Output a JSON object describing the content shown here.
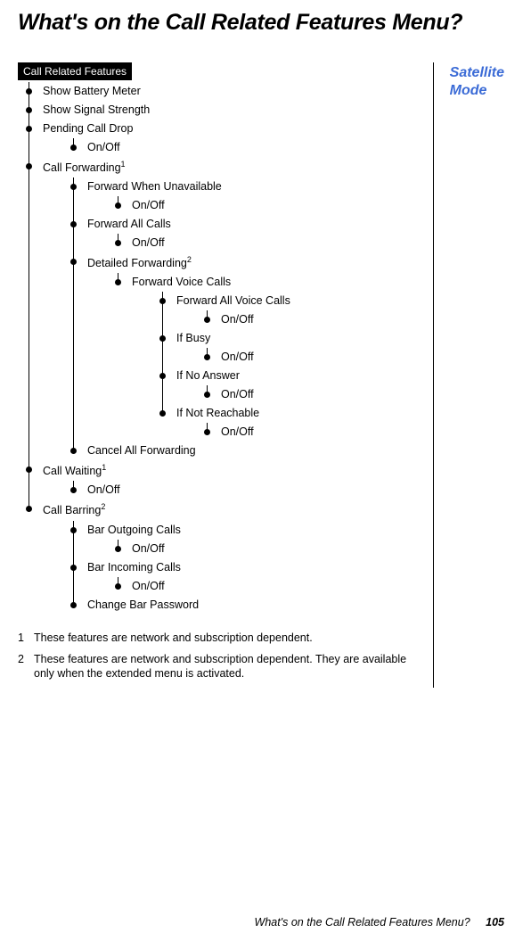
{
  "heading": "What's on the Call Related Features Menu?",
  "side_label_line1": "Satellite",
  "side_label_line2": "Mode",
  "root_tag": "Call Related Features",
  "tree": {
    "show_battery": "Show Battery Meter",
    "show_signal": "Show Signal Strength",
    "pending_call_drop": "Pending Call Drop",
    "pending_call_drop_onoff": "On/Off",
    "call_forwarding": "Call Forwarding",
    "call_forwarding_sup": "1",
    "cf_fwd_unavailable": "Forward When Unavailable",
    "cf_fwd_unavailable_onoff": "On/Off",
    "cf_fwd_all": "Forward All Calls",
    "cf_fwd_all_onoff": "On/Off",
    "cf_detailed": "Detailed Forwarding",
    "cf_detailed_sup": "2",
    "cf_fvc": "Forward Voice Calls",
    "cf_fvc_all": "Forward All Voice Calls",
    "cf_fvc_all_onoff": "On/Off",
    "cf_fvc_busy": "If Busy",
    "cf_fvc_busy_onoff": "On/Off",
    "cf_fvc_noanswer": "If No Answer",
    "cf_fvc_noanswer_onoff": "On/Off",
    "cf_fvc_notreach": "If Not Reachable",
    "cf_fvc_notreach_onoff": "On/Off",
    "cf_cancel_all": "Cancel All Forwarding",
    "call_waiting": "Call Waiting",
    "call_waiting_sup": "1",
    "call_waiting_onoff": "On/Off",
    "call_barring": "Call Barring",
    "call_barring_sup": "2",
    "cb_outgoing": "Bar Outgoing Calls",
    "cb_outgoing_onoff": "On/Off",
    "cb_incoming": "Bar Incoming Calls",
    "cb_incoming_onoff": "On/Off",
    "cb_change_pw": "Change Bar Password"
  },
  "footnotes": {
    "f1_num": "1",
    "f1_text": "These features are network and subscription dependent.",
    "f2_num": "2",
    "f2_text": "These features are network and subscription dependent. They are available only when the extended menu is activated."
  },
  "footer_text": "What's on the Call Related Features Menu?",
  "page_number": "105"
}
